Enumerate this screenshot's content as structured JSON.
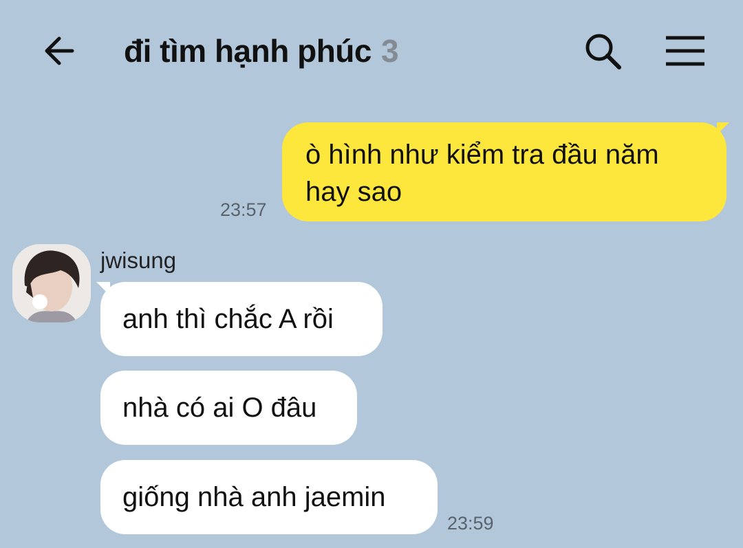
{
  "header": {
    "back_icon": "arrow-left-icon",
    "title": "đi tìm hạnh phúc",
    "member_count": "3",
    "search_icon": "search-icon",
    "menu_icon": "hamburger-menu-icon"
  },
  "colors": {
    "background": "#b2c7da",
    "outgoing_bubble": "#fee73c",
    "incoming_bubble": "#ffffff",
    "member_count": "#848b93",
    "timestamp": "#59636d"
  },
  "messages": {
    "outgoing": {
      "text": "ò hình như kiểm tra đầu năm hay sao",
      "time": "23:57"
    },
    "incoming": {
      "sender": "jwisung",
      "items": [
        {
          "text": "anh thì chắc A rồi"
        },
        {
          "text": "nhà có ai O đâu"
        },
        {
          "text": "giống nhà anh jaemin"
        }
      ],
      "time": "23:59"
    }
  }
}
